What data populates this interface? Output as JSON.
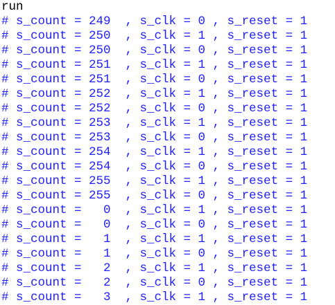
{
  "console": {
    "command": "run",
    "text_color_command": "#000000",
    "text_color_log": "#2020ff",
    "lines": [
      "# s_count = 249  , s_clk = 0 , s_reset = 1",
      "# s_count = 250  , s_clk = 1 , s_reset = 1",
      "# s_count = 250  , s_clk = 0 , s_reset = 1",
      "# s_count = 251  , s_clk = 1 , s_reset = 1",
      "# s_count = 251  , s_clk = 0 , s_reset = 1",
      "# s_count = 252  , s_clk = 1 , s_reset = 1",
      "# s_count = 252  , s_clk = 0 , s_reset = 1",
      "# s_count = 253  , s_clk = 1 , s_reset = 1",
      "# s_count = 253  , s_clk = 0 , s_reset = 1",
      "# s_count = 254  , s_clk = 1 , s_reset = 1",
      "# s_count = 254  , s_clk = 0 , s_reset = 1",
      "# s_count = 255  , s_clk = 1 , s_reset = 1",
      "# s_count = 255  , s_clk = 0 , s_reset = 1",
      "# s_count =   0  , s_clk = 1 , s_reset = 1",
      "# s_count =   0  , s_clk = 0 , s_reset = 1",
      "# s_count =   1  , s_clk = 1 , s_reset = 1",
      "# s_count =   1  , s_clk = 0 , s_reset = 1",
      "# s_count =   2  , s_clk = 1 , s_reset = 1",
      "# s_count =   2  , s_clk = 0 , s_reset = 1",
      "# s_count =   3  , s_clk = 1 , s_reset = 1"
    ]
  }
}
